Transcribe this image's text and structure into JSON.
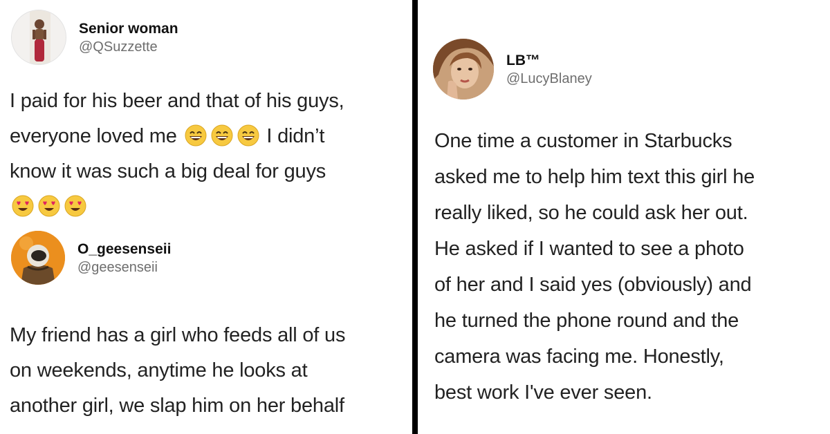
{
  "tweets": [
    {
      "display_name": "Senior woman",
      "handle": "@QSuzzette",
      "lines": [
        "I paid for his beer and that of his guys,",
        "everyone loved me",
        "I didn’t",
        "know it was such a big deal for guys"
      ],
      "inline_emojis": [
        "grinning-face-icon",
        "grinning-face-icon",
        "grinning-face-icon"
      ],
      "trailing_emojis": [
        "heart-eyes-face-icon",
        "heart-eyes-face-icon",
        "heart-eyes-face-icon"
      ]
    },
    {
      "display_name": "O_geesenseii",
      "handle": "@geesenseii",
      "lines": [
        "My friend has a girl who feeds all of us",
        "on weekends, anytime he looks at",
        "another girl, we slap him on her behalf"
      ]
    },
    {
      "display_name": "LB™",
      "handle": "@LucyBlaney",
      "lines": [
        "One time a customer in Starbucks",
        "asked me to help him text this girl he",
        "really liked, so he could ask her out.",
        "He asked if I wanted to see a photo",
        "of her and I said yes (obviously) and",
        "he turned the phone round and the",
        "camera was facing me. Honestly,",
        "best work I've ever seen."
      ]
    }
  ],
  "colors": {
    "divider": "#000000",
    "background": "#ffffff",
    "handle_gray": "#6e6e6e",
    "emoji_yellow": "#f7c940",
    "heart_red": "#e0245e"
  }
}
